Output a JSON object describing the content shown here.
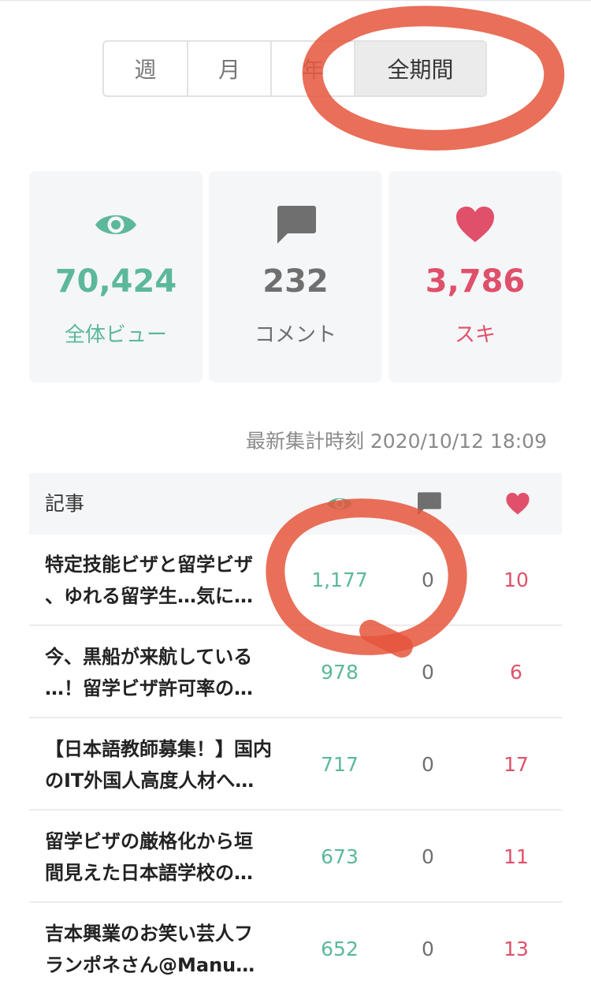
{
  "period_tabs": [
    {
      "label": "週",
      "selected": false
    },
    {
      "label": "月",
      "selected": false
    },
    {
      "label": "年",
      "selected": false
    },
    {
      "label": "全期間",
      "selected": true
    }
  ],
  "stats": {
    "views": {
      "value": "70,424",
      "label": "全体ビュー",
      "icon": "eye-icon",
      "color": "#5cb89a"
    },
    "comments": {
      "value": "232",
      "label": "コメント",
      "icon": "comment-icon",
      "color": "#6f6f6f"
    },
    "likes": {
      "value": "3,786",
      "label": "スキ",
      "icon": "heart-icon",
      "color": "#e0506a"
    }
  },
  "timestamp": "最新集計時刻 2020/10/12 18:09",
  "table": {
    "header": {
      "title": "記事",
      "icons": [
        "eye-icon",
        "comment-icon",
        "heart-icon"
      ]
    },
    "rows": [
      {
        "title": "特定技能ビザと留学ビザ\n、ゆれる留学生…気に…",
        "views": "1,177",
        "comments": "0",
        "likes": "10"
      },
      {
        "title": "今、黒船が来航している\n…！留学ビザ許可率の…",
        "views": "978",
        "comments": "0",
        "likes": "6"
      },
      {
        "title": "【日本語教師募集！】国内\nのIT外国人高度人材へ…",
        "views": "717",
        "comments": "0",
        "likes": "17"
      },
      {
        "title": "留学ビザの厳格化から垣\n間見えた日本語学校の…",
        "views": "673",
        "comments": "0",
        "likes": "11"
      },
      {
        "title": "吉本興業のお笑い芸人フ\nランポネさん@Manu…",
        "views": "652",
        "comments": "0",
        "likes": "13"
      }
    ]
  },
  "annotation_color": "#e5563c"
}
